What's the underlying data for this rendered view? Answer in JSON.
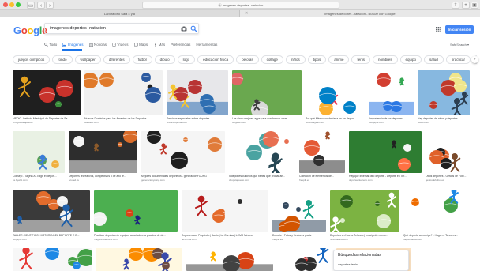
{
  "browser": {
    "address": "ⓐ imagenes deportes -natacion",
    "tabs": [
      {
        "label": "Laboratorio Sala 4 y 8"
      },
      {
        "label": "imagenes deportes -natacion - Buscar con Google"
      }
    ]
  },
  "google": {
    "logo_letters": [
      {
        "ch": "G",
        "color": "#4285F4"
      },
      {
        "ch": "o",
        "color": "#EA4335"
      },
      {
        "ch": "o",
        "color": "#FBBC05"
      },
      {
        "ch": "g",
        "color": "#4285F4"
      },
      {
        "ch": "l",
        "color": "#34A853"
      },
      {
        "ch": "e",
        "color": "#EA4335"
      }
    ],
    "query": "imagenes deportes -natacion",
    "signin_label": "Iniciar sesión",
    "safesearch_label": "SafeSearch ▾"
  },
  "menu": [
    {
      "label": "Todo",
      "icon": "search-icon",
      "active": false
    },
    {
      "label": "Imágenes",
      "icon": "image-icon",
      "active": true
    },
    {
      "label": "Noticias",
      "icon": "news-icon",
      "active": false
    },
    {
      "label": "Vídeos",
      "icon": "video-icon",
      "active": false
    },
    {
      "label": "Maps",
      "icon": "map-icon",
      "active": false
    },
    {
      "label": "Más",
      "icon": "more-icon",
      "active": false
    },
    {
      "label": "Preferencias",
      "icon": "",
      "active": false
    },
    {
      "label": "Herramientas",
      "icon": "",
      "active": false
    }
  ],
  "chips": [
    "juegos olimpicos",
    "fondo",
    "wallpaper",
    "diferentes",
    "futbol",
    "dibujo",
    "logo",
    "educacion fisica",
    "pelotas",
    "collage",
    "niños",
    "tipos",
    "anime",
    "tenis",
    "nombres",
    "equipo",
    "salud",
    "practicar",
    "dibujos animados",
    "mujer",
    "para niñ"
  ],
  "rows": [
    {
      "tiles": [
        {
          "caption": "MEDIO. Instituto Municipal de Deportes de Sa...",
          "source": "imd.guadaíajara.es",
          "colors": [
            "#1f1f1f",
            "#c8322b",
            "#3a8f3b",
            "#e4a21f"
          ]
        },
        {
          "caption": "Nuevos Dominios para los Amantes de los Deportes",
          "source": "blablaso.com",
          "colors": [
            "#f1f1f1",
            "#e07a2a",
            "#2b5aa0",
            "#222222"
          ]
        },
        {
          "caption": "Servicios especiales sobre deportes",
          "source": "enoticiasportal.com",
          "colors": [
            "#e7e7ea",
            "#b83434",
            "#2f6fb2",
            "#f4c430"
          ]
        },
        {
          "caption": "Las cinco mejores apps para quedar con otras...",
          "source": "blogtrek.com",
          "colors": [
            "#6aa84f",
            "#e06666",
            "#d9d9d9",
            "#3d3d3d"
          ]
        },
        {
          "caption": "Por qué México no destaca en los deport...",
          "source": "aztecadigital.com",
          "colors": [
            "#ffffff",
            "#0081c8",
            "#fcb131",
            "#ee334e"
          ]
        },
        {
          "caption": "Importancia de los deportes",
          "source": "blogspot.com",
          "colors": [
            "#ffffff",
            "#d23f31",
            "#2b78e4",
            "#34a853"
          ]
        },
        {
          "caption": "Hay deportes de niños y deportes",
          "source": "eldiario.es",
          "colors": [
            "#87b8e0",
            "#c0392b",
            "#f0e68c",
            "#2c3e50"
          ]
        }
      ]
    },
    {
      "tiles": [
        {
          "caption": "Consejo - Tarjeta A - Elige el deport...",
          "source": "es.bywiki.com",
          "colors": [
            "#e9f1e4",
            "#f0b040",
            "#58a054",
            "#3b7dd8"
          ]
        },
        {
          "caption": "Deportes recreativos, competitivos o de alto re...",
          "source": "ecured.cu",
          "colors": [
            "#2d2d2d",
            "#d96c2a",
            "#f5f5f5",
            "#8c5a2b"
          ]
        },
        {
          "caption": "Mejores documentales deportivos - generacionYOUNG",
          "source": "generacionyoung.com",
          "colors": [
            "#f5f5f5",
            "#e07b39",
            "#1e1e1e",
            "#c0392b"
          ]
        },
        {
          "caption": "5 deportes curiosos que tienes que probar an...",
          "source": "chupetapuerto.com",
          "colors": [
            "#ffffff",
            "#4aa3a1",
            "#e76f51",
            "#264653"
          ]
        },
        {
          "caption": "Colección de elementos de...",
          "source": "freepik.es",
          "colors": [
            "#ffffff",
            "#e45a35",
            "#2f2f2f",
            "#a0522d"
          ]
        },
        {
          "caption": "Hay que inventar otro deporte - Deporte en Ter...",
          "source": "deporteenterreno.com",
          "colors": [
            "#2e7d32",
            "#f5f5f5",
            "#ff7043",
            "#212121"
          ]
        },
        {
          "caption": "Otros deportes - Gestos de Fútb...",
          "source": "gestosdefutbol.es",
          "colors": [
            "#ffffff",
            "#e0612a",
            "#1f1f1f",
            "#7a4a2a"
          ]
        }
      ]
    },
    {
      "tiles": [
        {
          "caption": "TALLER CIENTIFICO: HISTORIA DEL DEPORTE E D...",
          "source": "blogspot.com",
          "colors": [
            "#3a3a3a",
            "#e36c2c",
            "#f2f2f2",
            "#1f5fa8"
          ]
        },
        {
          "caption": "Practicar deportes de equipos asociado a la practica de de...",
          "source": "magazinedeporte.com",
          "colors": [
            "#4caf50",
            "#f4f4f4",
            "#d84315",
            "#1a237e"
          ]
        },
        {
          "caption": "Deportes con Propósito | Audio | La Cornisa | LCMS México",
          "source": "lacornisa.com",
          "colors": [
            "#f5f5f5",
            "#e46a2a",
            "#2b2b2b",
            "#b71c1c"
          ]
        },
        {
          "caption": "Deporte | Fotos y Vectores gratis",
          "source": "freepik.es",
          "colors": [
            "#ffffff",
            "#d35400",
            "#34495e",
            "#16a085"
          ]
        },
        {
          "caption": "Deportes en Nueva Zelanda | Inscripción como...",
          "source": "newzealand.com",
          "colors": [
            "#7cb342",
            "#dcedc8",
            "#33691e",
            "#ffffff"
          ]
        },
        {
          "caption": "Qué deporte se corrige? - Hago mi Tarea es...",
          "source": "hagomitarea.com",
          "colors": [
            "#ffffff",
            "#ef6c00",
            "#43a047",
            "#1e88e5"
          ]
        }
      ]
    },
    {
      "tiles": [
        {
          "caption": "",
          "source": "",
          "colors": [
            "#f7f7f7",
            "#1e88e5",
            "#43a047",
            "#e53935"
          ]
        },
        {
          "caption": "",
          "source": "",
          "colors": [
            "#fff8e1",
            "#fb8c00",
            "#6d4c41",
            "#3949ab"
          ]
        },
        {
          "caption": "",
          "source": "",
          "colors": [
            "#ffffff",
            "#d84315",
            "#424242",
            "#ffb300"
          ]
        },
        {
          "caption": "",
          "source": "",
          "colors": [
            "#ffffff",
            "#2e2e2e",
            "#c62828",
            "#1565c0"
          ]
        },
        {
          "caption": "",
          "source": "",
          "colors": [
            "#fbe2c3",
            "#f57c00",
            "#5d4037",
            "#ffcc80"
          ]
        }
      ]
    }
  ],
  "related": {
    "title": "Búsquedas relacionadas",
    "items": [
      "deportes tenis"
    ]
  }
}
